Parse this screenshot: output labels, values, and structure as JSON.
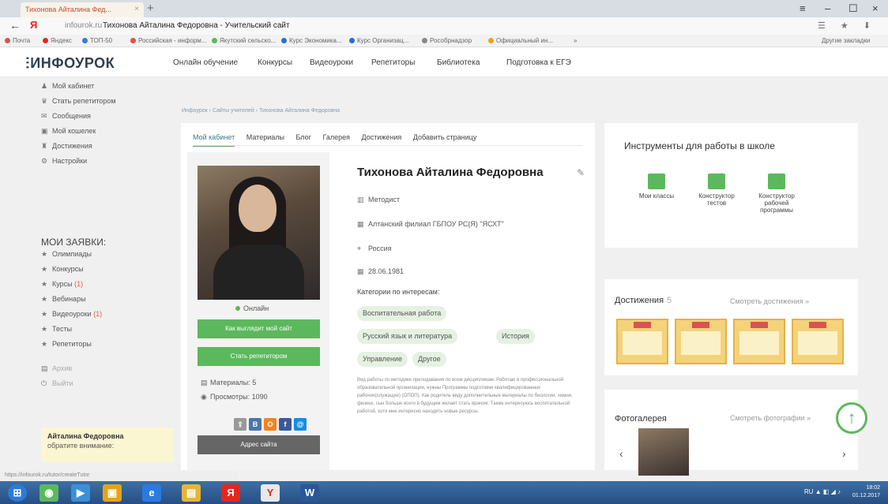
{
  "browser": {
    "tab_title": "Тихонова Айталина Фед...",
    "tab_close": "×",
    "new_tab": "+",
    "menu_icon": "≡",
    "minimize": "–",
    "maximize": "☐",
    "close": "×",
    "back": "←",
    "yandex_logo": "Я",
    "domain": "infourok.ru",
    "page_title": "Тихонова Айталина Федоровна - Учительский сайт",
    "right_icons": "☰ ★ ⬇",
    "bookmarks": [
      {
        "label": "Почта",
        "color": "#d9534f"
      },
      {
        "label": "Яндекс",
        "color": "#e52620"
      },
      {
        "label": "ТОП-50",
        "color": "#3a7bd5"
      },
      {
        "label": "Российская - информ...",
        "color": "#d9534f"
      },
      {
        "label": "Якутский сельско...",
        "color": "#5cb85c"
      },
      {
        "label": "Курс Экономика...",
        "color": "#2a6fd6"
      },
      {
        "label": "Курс Организац...",
        "color": "#2a6fd6"
      },
      {
        "label": "Рособрнадзор",
        "color": "#888888"
      },
      {
        "label": "Официальный ин...",
        "color": "#e8a317"
      },
      {
        "label": "»",
        "color": ""
      },
      {
        "label": "Другие закладки",
        "color": ""
      }
    ]
  },
  "site": {
    "logo": "ИНФОУРОК",
    "nav": [
      "Онлайн обучение",
      "Конкурсы",
      "Видеоуроки",
      "Репетиторы",
      "Библиотека",
      "Подготовка к ЕГЭ"
    ]
  },
  "sidebar": {
    "items": [
      {
        "label": "Мой кабинет",
        "icon": "user-icon",
        "glyph": "♟"
      },
      {
        "label": "Стать репетитором",
        "icon": "graduation-cap-icon",
        "glyph": "♛"
      },
      {
        "label": "Сообщения",
        "icon": "envelope-icon",
        "glyph": "✉"
      },
      {
        "label": "Мой кошелек",
        "icon": "wallet-icon",
        "glyph": "▣"
      },
      {
        "label": "Достижения",
        "icon": "trophy-icon",
        "glyph": "♜"
      },
      {
        "label": "Настройки",
        "icon": "gear-icon",
        "glyph": "⚙"
      }
    ],
    "section_title": "МОИ ЗАЯВКИ:",
    "requests": [
      {
        "label": "Олимпиады",
        "count": ""
      },
      {
        "label": "Конкурсы",
        "count": ""
      },
      {
        "label": "Курсы",
        "count": "(1)"
      },
      {
        "label": "Вебинары",
        "count": ""
      },
      {
        "label": "Видеоуроки",
        "count": "(1)"
      },
      {
        "label": "Тесты",
        "count": ""
      },
      {
        "label": "Репетиторы",
        "count": ""
      }
    ],
    "extra": [
      "Архив",
      "Выйти"
    ],
    "star_glyph": "★",
    "notice_name": "Айталина Федоровна",
    "notice_text": "обратите внимание:"
  },
  "profile": {
    "breadcrumb": "Инфоурок › Сайты учителей › Тихонова Айталина Федоровна",
    "tabs": [
      "Мой кабинет",
      "Материалы",
      "Блог",
      "Галерея",
      "Достижения",
      "Добавить страницу"
    ],
    "name": "Тихонова Айталина Федоровна",
    "position": "Методист",
    "organization": "Алтанский филиал ГБПОУ РС(Я) \"ЯСХТ\"",
    "country": "Россия",
    "birthdate": "28.06.1981",
    "categories_label": "Категории по интересам:",
    "tags": [
      "Воспитательная работа",
      "Русский язык и литература",
      "История",
      "Управление",
      "Другое"
    ],
    "bio": "Вид работы по методике преподавания по всем дисциплинам. Работаю в профессиональной образовательной организации, нужны Программы подготовки квалифицированных рабочих(служащих) (ОПОП). Как родитель веду дополнительные материалы по биологии, химии, физике, сын больше всего в будущем желает стать врачом. Также интересуюсь воспитательной работой, хотя мне интересно находить новые ресурсы.",
    "online": "Онлайн",
    "btn_site_view": "Как выглядит мой сайт",
    "btn_tutor": "Стать репетитором",
    "materials": "Материалы: 5",
    "views": "Просмотры: 1090",
    "address_btn": "Адрес сайта",
    "social": [
      {
        "glyph": "В",
        "color": "#4a76a8"
      },
      {
        "glyph": "О",
        "color": "#f58220"
      },
      {
        "glyph": "f",
        "color": "#3b5998"
      },
      {
        "glyph": "@",
        "color": "#168de2"
      }
    ],
    "edit_glyph": "✎"
  },
  "right": {
    "tools_title": "Инструменты для работы в школе",
    "tools": [
      "Мои классы",
      "Конструктор тестов",
      "Конструктор рабочей программы"
    ],
    "achievements_title": "Достижения",
    "achievements_count": "5",
    "achievements_link": "Смотреть достижения »",
    "gallery_title": "Фотогалерея",
    "gallery_link": "Смотреть фотографии »",
    "prev": "‹",
    "next": "›",
    "up": "↑"
  },
  "status_url": "https://infourok.ru/tutor/createTutor",
  "taskbar": {
    "icons": [
      {
        "name": "start-orb-icon",
        "color": "#2f7ad6",
        "glyph": "⊞"
      },
      {
        "name": "browser-icon",
        "color": "#5cb85c",
        "glyph": "◉"
      },
      {
        "name": "media-player-icon",
        "color": "#3b8fd9",
        "glyph": "▶"
      },
      {
        "name": "explorer-icon",
        "color": "#e8a317",
        "glyph": "▣"
      },
      {
        "name": "ie-icon",
        "color": "#2a7be0",
        "glyph": "e"
      },
      {
        "name": "folder-icon",
        "color": "#e5b53a",
        "glyph": "▤"
      },
      {
        "name": "yandex-icon",
        "color": "#e52620",
        "glyph": "Я"
      },
      {
        "name": "yandex-browser-icon",
        "color": "#e8e8e8",
        "glyph": "Y"
      },
      {
        "name": "word-icon",
        "color": "#2b5797",
        "glyph": "W"
      }
    ],
    "lang": "RU",
    "tray_glyphs": "▲ ◧ ◢ ♪",
    "time": "18:02",
    "date": "01.12.2017"
  }
}
